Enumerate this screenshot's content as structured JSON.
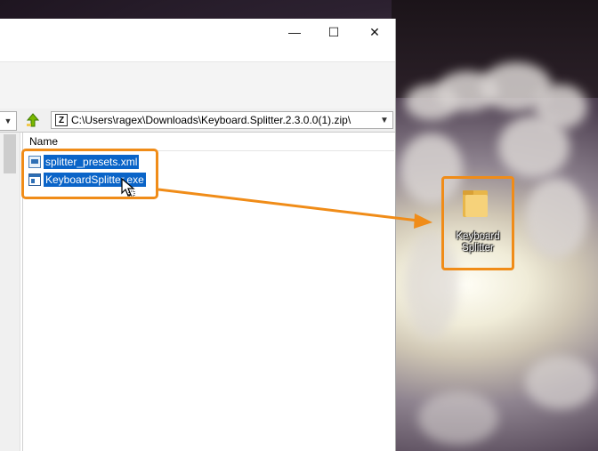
{
  "window": {
    "caption": {
      "minimize": "—",
      "maximize": "☐",
      "close": "✕"
    },
    "address": {
      "path": "C:\\Users\\ragex\\Downloads\\Keyboard.Splitter.2.3.0.0(1).zip\\",
      "path_icon": "Z"
    },
    "list": {
      "column_name": "Name",
      "files": [
        {
          "name": "splitter_presets.xml",
          "icon": "xml-file-icon"
        },
        {
          "name": "KeyboardSplitter.exe",
          "icon": "exe-file-icon"
        }
      ]
    }
  },
  "desktop": {
    "folder_label_line1": "Keyboard",
    "folder_label_line2": "Splitter"
  },
  "colors": {
    "highlight": "#f08c18",
    "selection": "#0a64c8"
  }
}
